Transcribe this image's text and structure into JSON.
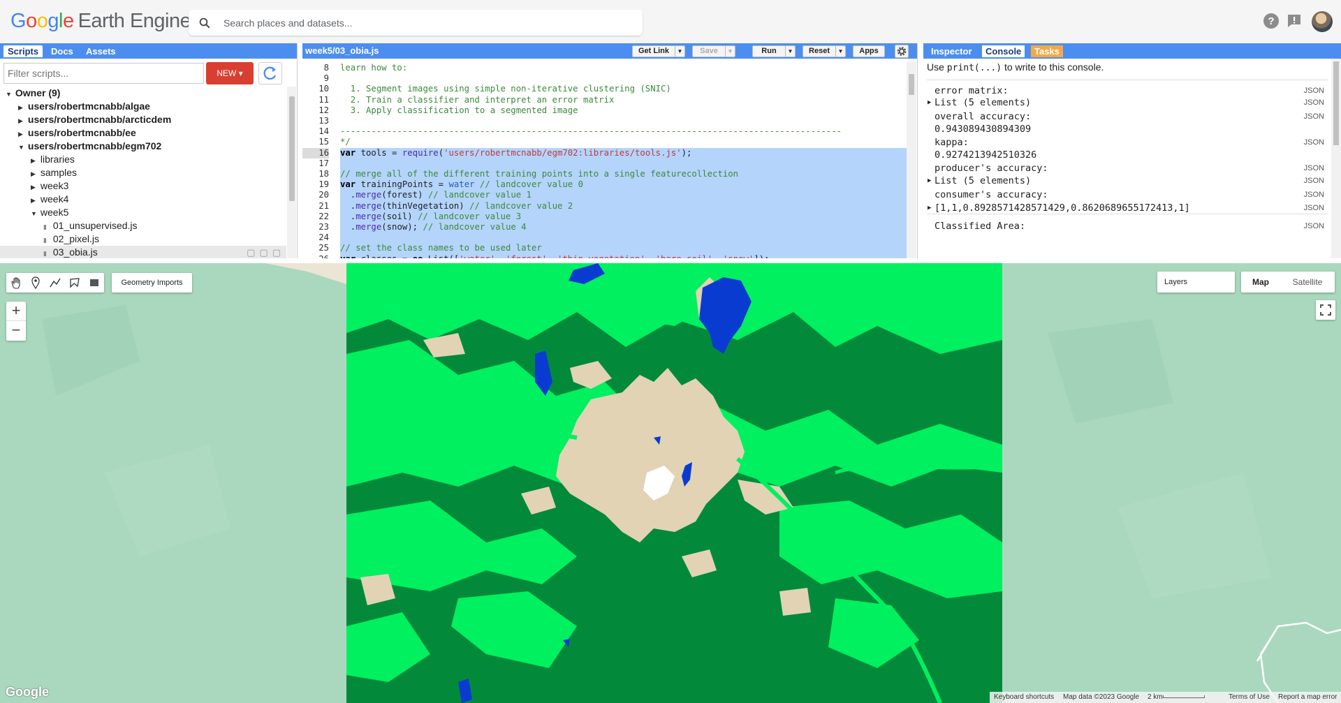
{
  "header": {
    "logo_google": "Google",
    "logo_product": "Earth Engine",
    "search_placeholder": "Search places and datasets...",
    "icons": [
      "help-icon",
      "feedback-icon",
      "avatar"
    ]
  },
  "left_panel": {
    "tabs": [
      {
        "label": "Scripts",
        "active": true
      },
      {
        "label": "Docs"
      },
      {
        "label": "Assets"
      }
    ],
    "filter_placeholder": "Filter scripts...",
    "new_button": "NEW",
    "tree": [
      {
        "label": "Owner (9)",
        "indent": 0,
        "expanded": true,
        "bold": true
      },
      {
        "label": "users/robertmcnabb/algae",
        "indent": 1,
        "expanded": false,
        "bold": true
      },
      {
        "label": "users/robertmcnabb/arcticdem",
        "indent": 1,
        "expanded": false,
        "bold": true
      },
      {
        "label": "users/robertmcnabb/ee",
        "indent": 1,
        "expanded": false,
        "bold": true
      },
      {
        "label": "users/robertmcnabb/egm702",
        "indent": 1,
        "expanded": true,
        "bold": true
      },
      {
        "label": "libraries",
        "indent": 2,
        "expanded": false
      },
      {
        "label": "samples",
        "indent": 2,
        "expanded": false
      },
      {
        "label": "week3",
        "indent": 2,
        "expanded": false
      },
      {
        "label": "week4",
        "indent": 2,
        "expanded": false
      },
      {
        "label": "week5",
        "indent": 2,
        "expanded": true
      },
      {
        "label": "01_unsupervised.js",
        "indent": 3,
        "file": true
      },
      {
        "label": "02_pixel.js",
        "indent": 3,
        "file": true
      },
      {
        "label": "03_obia.js",
        "indent": 3,
        "file": true,
        "selected": true
      }
    ]
  },
  "editor": {
    "filename": "week5/03_obia.js",
    "buttons": {
      "get_link": "Get Link",
      "save": "Save",
      "run": "Run",
      "reset": "Reset",
      "apps": "Apps"
    },
    "lines": [
      {
        "n": "8",
        "t": "learn how to:",
        "cls": "c-com"
      },
      {
        "n": "9",
        "t": "",
        "cls": "c-com"
      },
      {
        "n": "10",
        "t": "  1. Segment images using simple non-iterative clustering (SNIC)",
        "cls": "c-com"
      },
      {
        "n": "11",
        "t": "  2. Train a classifier and interpret an error matrix",
        "cls": "c-com"
      },
      {
        "n": "12",
        "t": "  3. Apply classification to a segmented image",
        "cls": "c-com"
      },
      {
        "n": "13",
        "t": "",
        "cls": "c-com"
      },
      {
        "n": "14",
        "t": "-------------------------------------------------------------------------------------------------",
        "cls": "c-com"
      },
      {
        "n": "15",
        "t": "*/",
        "cls": "c-com"
      },
      {
        "n": "16",
        "t": "var tools = require('users/robertmcnabb/egm702:libraries/tools.js');",
        "cls": "code16"
      },
      {
        "n": "17",
        "t": "",
        "cls": ""
      },
      {
        "n": "18",
        "t": "// merge all of the different training points into a single featurecollection",
        "cls": "c-com"
      },
      {
        "n": "19",
        "t": "var trainingPoints = water // landcover value 0",
        "cls": "code19"
      },
      {
        "n": "20",
        "t": "  .merge(forest) // landcover value 1",
        "cls": "merge"
      },
      {
        "n": "21",
        "t": "  .merge(thinVegetation) // landcover value 2",
        "cls": "merge"
      },
      {
        "n": "22",
        "t": "  .merge(soil) // landcover value 3",
        "cls": "merge"
      },
      {
        "n": "23",
        "t": "  .merge(snow); // landcover value 4",
        "cls": "merge"
      },
      {
        "n": "24",
        "t": "",
        "cls": ""
      },
      {
        "n": "25",
        "t": "// set the class names to be used later",
        "cls": "c-com"
      },
      {
        "n": "26",
        "t": "var classes = ee.List(['water', 'forest', 'thin vegetation', 'bare soil', 'snow']);",
        "cls": "code26"
      }
    ]
  },
  "right_panel": {
    "tabs": [
      {
        "label": "Inspector"
      },
      {
        "label": "Console",
        "active": true
      },
      {
        "label": "Tasks"
      }
    ],
    "hint_prefix": "Use ",
    "hint_code": "print(...)",
    "hint_suffix": " to write to this console.",
    "entries": [
      {
        "text": "error matrix:",
        "json": "JSON",
        "expand": false
      },
      {
        "text": "List (5 elements)",
        "json": "JSON",
        "expand": true
      },
      {
        "text": "overall accuracy:",
        "json": "JSON",
        "expand": false
      },
      {
        "text": "0.943089430894309",
        "json": "",
        "expand": false
      },
      {
        "text": "kappa:",
        "json": "JSON",
        "expand": false
      },
      {
        "text": "0.9274213942510326",
        "json": "",
        "expand": false
      },
      {
        "text": "producer's accuracy:",
        "json": "JSON",
        "expand": false
      },
      {
        "text": "List (5 elements)",
        "json": "JSON",
        "expand": true
      },
      {
        "text": "consumer's accuracy:",
        "json": "JSON",
        "expand": false
      },
      {
        "text": "[1,1,0.8928571428571429,0.8620689655172413,1]",
        "json": "JSON",
        "expand": true
      },
      {
        "text": "Classified Area:",
        "json": "JSON",
        "expand": false
      }
    ]
  },
  "map": {
    "geometry_imports": "Geometry Imports",
    "zoom_in": "+",
    "zoom_out": "−",
    "layers_label": "Layers",
    "map_button": "Map",
    "satellite_button": "Satellite",
    "watermark": "Google",
    "attribution": {
      "shortcuts": "Keyboard shortcuts",
      "map_data": "Map data ©2023 Google",
      "scale": "2 km",
      "terms": "Terms of Use",
      "report": "Report a map error"
    },
    "colors": {
      "forest": "#028a3a",
      "thin_vegetation": "#00f060",
      "bare_soil": "#e2d3b5",
      "water": "#0a3bd1",
      "snow": "#ffffff",
      "basemap": "#a8d7bd"
    }
  }
}
